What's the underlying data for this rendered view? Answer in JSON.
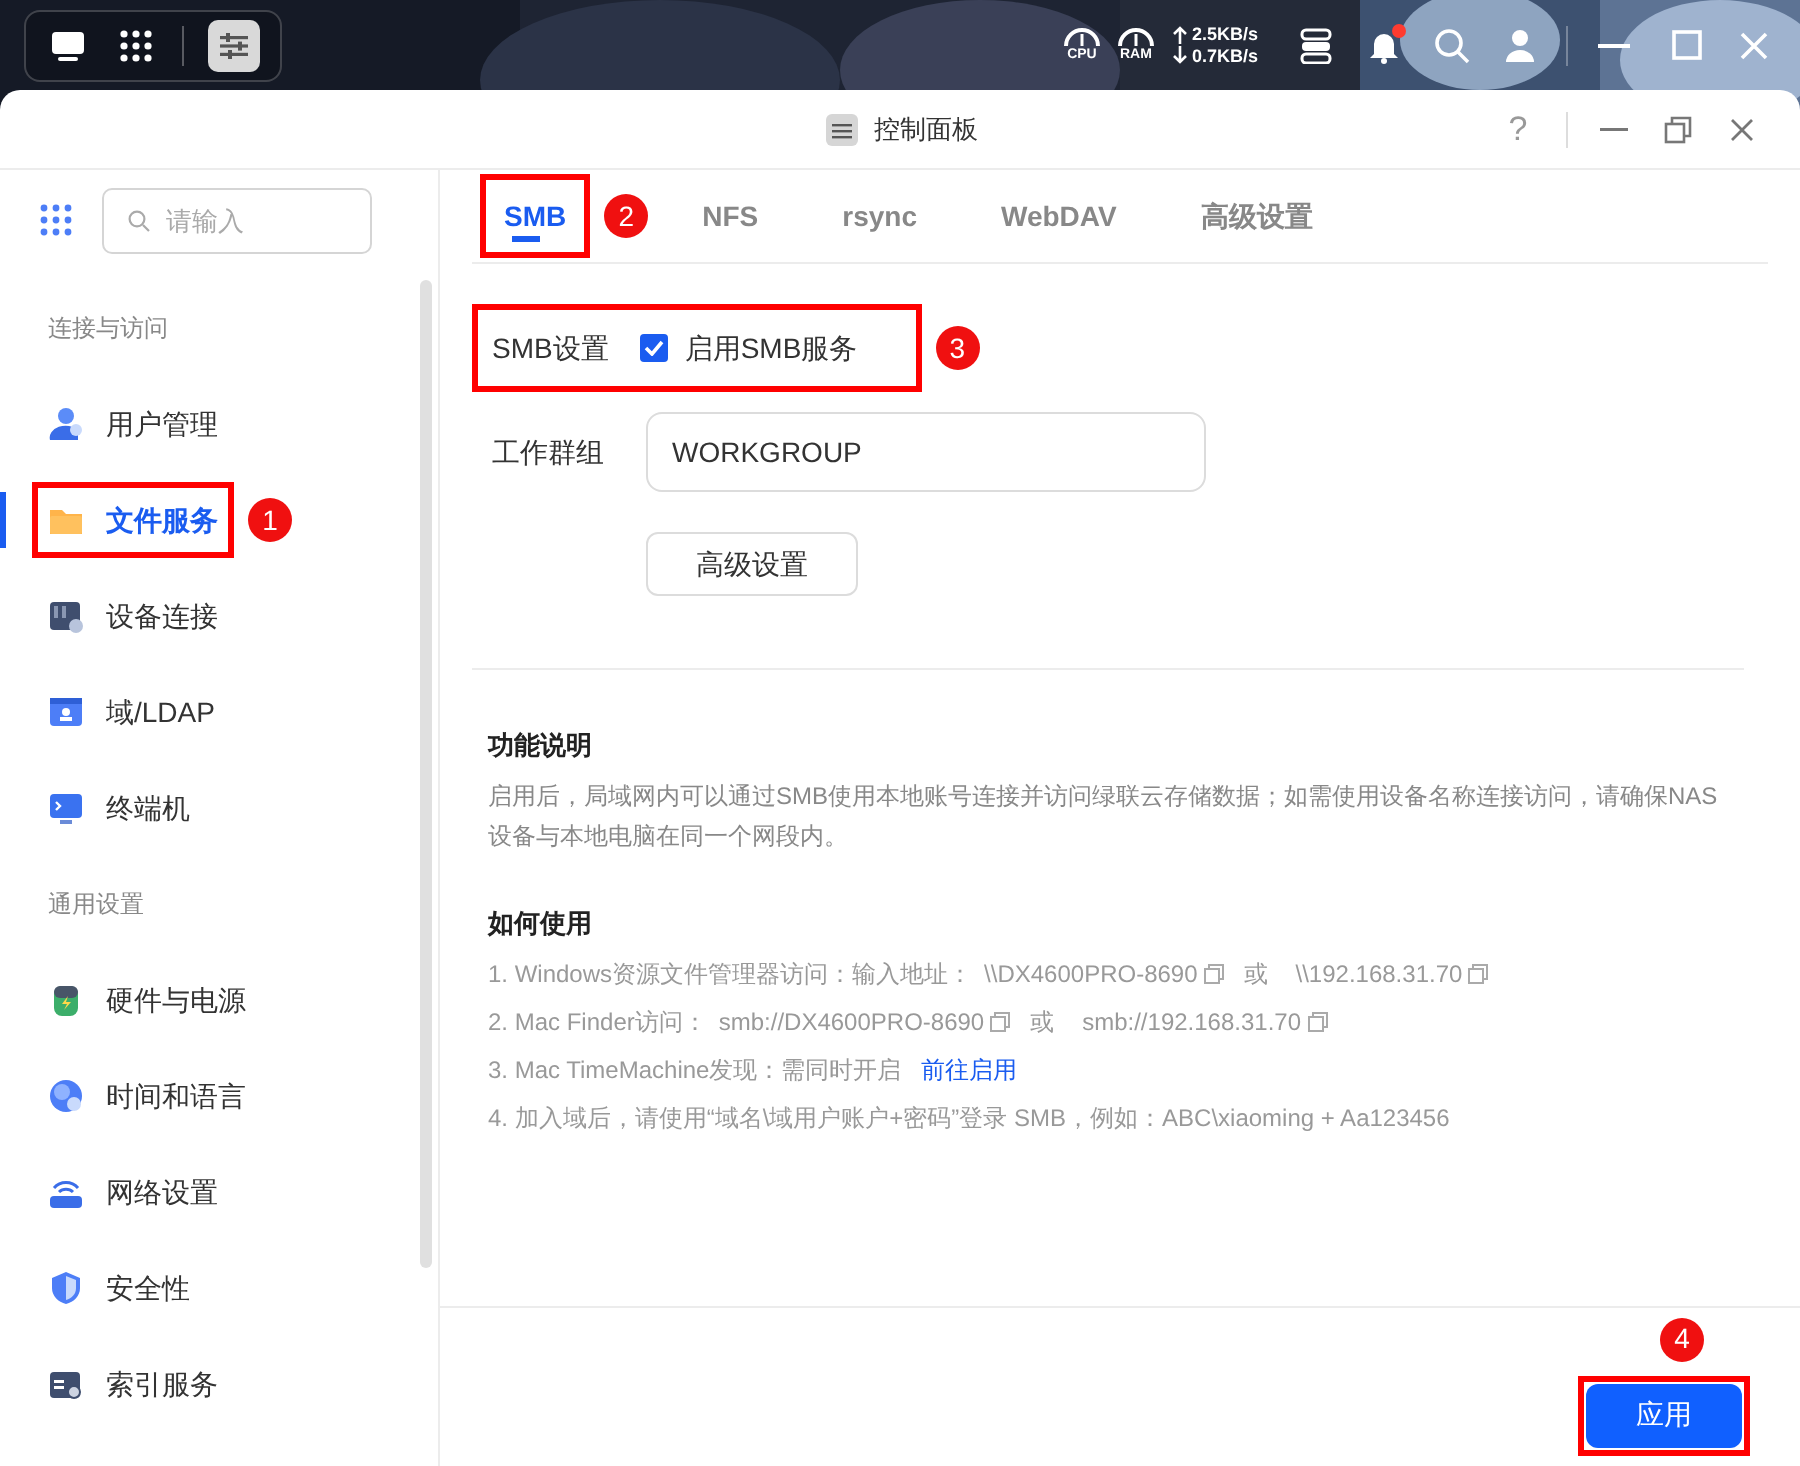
{
  "topbar": {
    "cpu_label": "CPU",
    "ram_label": "RAM",
    "upload": "2.5KB/s",
    "download": "0.7KB/s",
    "has_notification": true
  },
  "window": {
    "title": "控制面板",
    "help": "?"
  },
  "sidebar": {
    "search_placeholder": "请输入",
    "sections": [
      {
        "title": "连接与访问",
        "items": [
          {
            "label": "用户管理",
            "selected": false
          },
          {
            "label": "文件服务",
            "selected": true,
            "annotation": "1"
          },
          {
            "label": "设备连接",
            "selected": false
          },
          {
            "label": "域/LDAP",
            "selected": false
          },
          {
            "label": "终端机",
            "selected": false
          }
        ]
      },
      {
        "title": "通用设置",
        "items": [
          {
            "label": "硬件与电源",
            "selected": false
          },
          {
            "label": "时间和语言",
            "selected": false
          },
          {
            "label": "网络设置",
            "selected": false
          },
          {
            "label": "安全性",
            "selected": false
          },
          {
            "label": "索引服务",
            "selected": false
          }
        ]
      }
    ]
  },
  "tabs": [
    {
      "label": "SMB",
      "selected": true,
      "annotation": "2"
    },
    {
      "label": "NFS",
      "selected": false
    },
    {
      "label": "rsync",
      "selected": false
    },
    {
      "label": "WebDAV",
      "selected": false
    },
    {
      "label": "高级设置",
      "selected": false
    }
  ],
  "smb": {
    "label": "SMB设置",
    "enable": {
      "label": "启用SMB服务",
      "checked": true
    },
    "annotation": "3"
  },
  "workgroup": {
    "label": "工作群组",
    "value": "WORKGROUP"
  },
  "advanced_button": "高级设置",
  "description": {
    "title": "功能说明",
    "text": "启用后，局域网内可以通过SMB使用本地账号连接并访问绿联云存储数据；如需使用设备名称连接访问，请确保NAS设备与本地电脑在同一个网段内。"
  },
  "usage": {
    "title": "如何使用",
    "lines": [
      [
        {
          "kind": "text",
          "text": "1. Windows资源文件管理器访问：输入地址："
        },
        {
          "kind": "copy",
          "text": "\\\\DX4600PRO-8690"
        },
        {
          "kind": "text",
          "text": "或"
        },
        {
          "kind": "copy",
          "text": "\\\\192.168.31.70"
        }
      ],
      [
        {
          "kind": "text",
          "text": "2. Mac Finder访问："
        },
        {
          "kind": "copy",
          "text": "smb://DX4600PRO-8690"
        },
        {
          "kind": "text",
          "text": "或"
        },
        {
          "kind": "copy",
          "text": "smb://192.168.31.70"
        }
      ],
      [
        {
          "kind": "text",
          "text": "3. Mac TimeMachine发现：需同时开启"
        },
        {
          "kind": "link",
          "text": "前往启用"
        }
      ],
      [
        {
          "kind": "text",
          "text": "4. 加入域后，请使用“域名\\域用户账户+密码”登录 SMB，例如：ABC\\xiaoming + Aa123456"
        }
      ]
    ]
  },
  "apply_button": {
    "label": "应用",
    "annotation": "4"
  }
}
